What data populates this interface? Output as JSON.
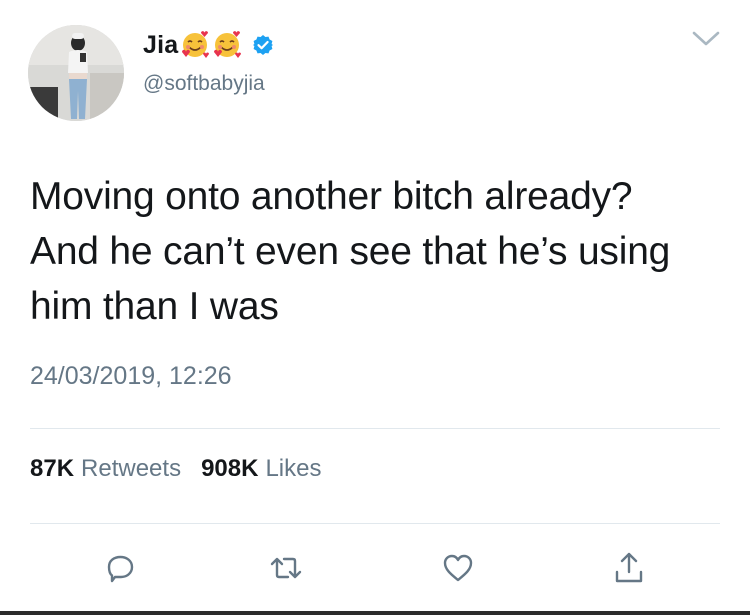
{
  "user": {
    "display_name": "Jia",
    "emojis": [
      "smiling-face-with-hearts",
      "smiling-face-with-hearts"
    ],
    "verified": true,
    "handle": "@softbabyjia"
  },
  "tweet": {
    "text": "Moving onto another bitch already?\nAnd he can’t even see that he’s using\nhim than I was",
    "timestamp": "24/03/2019, 12:26"
  },
  "stats": {
    "retweets_count": "87K",
    "retweets_label": "Retweets",
    "likes_count": "908K",
    "likes_label": "Likes"
  },
  "actions": {
    "reply_icon": "reply-icon",
    "retweet_icon": "retweet-icon",
    "like_icon": "heart-icon",
    "share_icon": "share-icon"
  },
  "colors": {
    "text_primary": "#14171a",
    "text_secondary": "#657786",
    "verified_blue": "#1da1f2",
    "divider": "#e1e8ed"
  }
}
